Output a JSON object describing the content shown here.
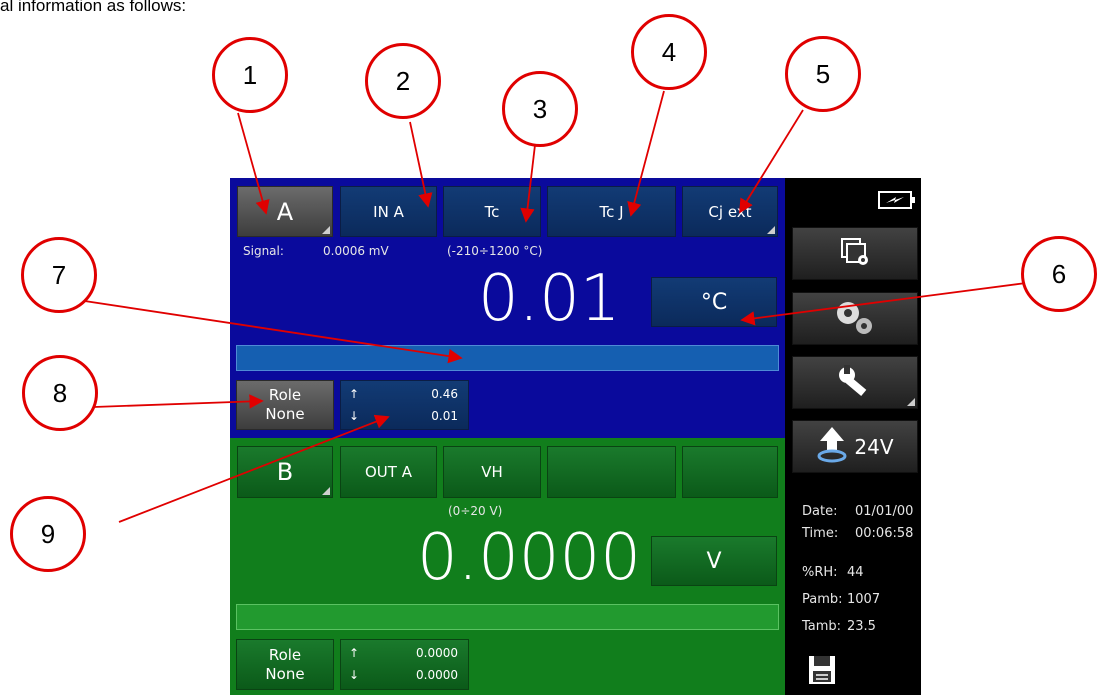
{
  "partial_caption": "al information as follows:",
  "channel_a": {
    "channel_label": "A",
    "input_label": "IN A",
    "signal_type": "Tc",
    "sensor_type": "Tc J",
    "cj_label": "Cj ext",
    "signal_label": "Signal:",
    "signal_value": "0.0006 mV",
    "range": "(-210÷1200 °C)",
    "value": "0.01",
    "unit": "°C",
    "role_line1": "Role",
    "role_line2": "None",
    "max_arrow": "↑",
    "min_arrow": "↓",
    "max": "0.46",
    "min": "0.01"
  },
  "channel_b": {
    "channel_label": "B",
    "output_label": "OUT A",
    "signal_type": "VH",
    "range": "(0÷20 V)",
    "value": "0.0000",
    "unit": "V",
    "role_line1": "Role",
    "role_line2": "None",
    "max_arrow": "↑",
    "min_arrow": "↓",
    "max": "0.0000",
    "min": "0.0000"
  },
  "sidebar": {
    "supply_label": "24V",
    "date_label": "Date:",
    "date_value": "01/01/00",
    "time_label": "Time:",
    "time_value": "00:06:58",
    "rh_label": "%RH:",
    "rh_value": "44",
    "pamb_label": "Pamb:",
    "pamb_value": "1007",
    "tamb_label": "Tamb:",
    "tamb_value": "23.5",
    "icons": [
      "battery-charging-icon",
      "window-settings-icon",
      "gears-icon",
      "wrench-icon",
      "supply-arrow-icon",
      "save-icon"
    ]
  },
  "callouts": [
    "1",
    "2",
    "3",
    "4",
    "5",
    "6",
    "7",
    "8",
    "9"
  ],
  "colors": {
    "panel_a": "#0a0a9c",
    "panel_b": "#117e1c",
    "callout": "#e00000"
  }
}
